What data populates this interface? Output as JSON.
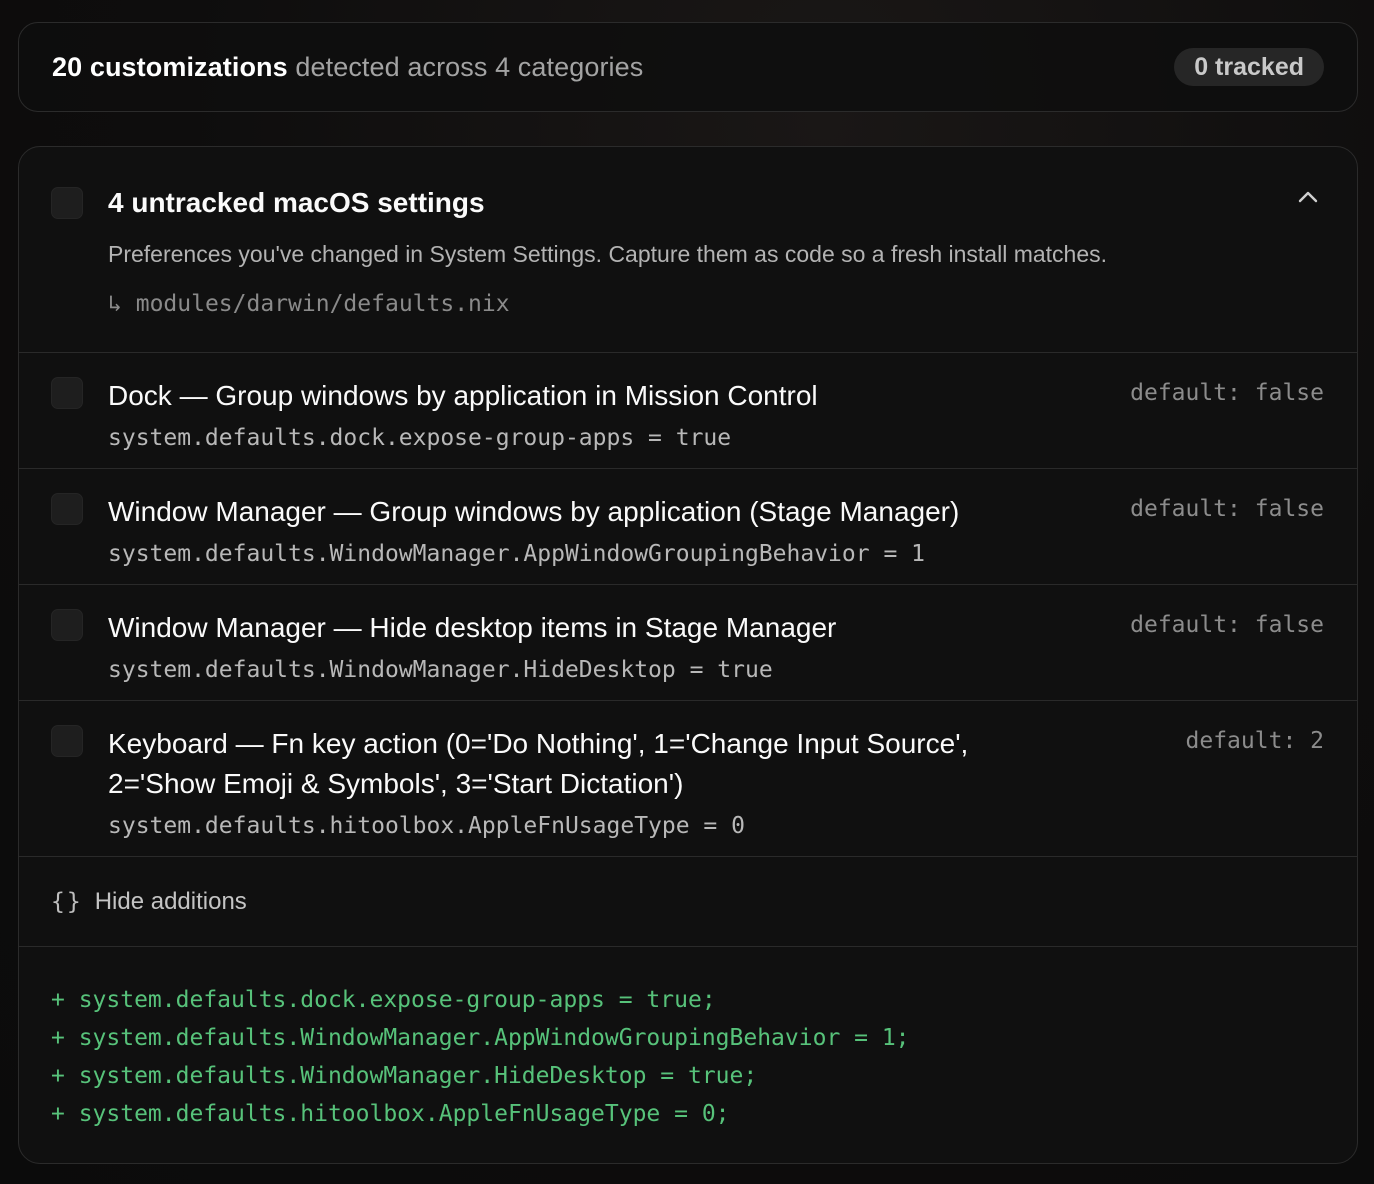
{
  "summary": {
    "count_text": "20 customizations",
    "rest_text": " detected across 4 categories",
    "tracked_badge": "0 tracked"
  },
  "group": {
    "title": "4 untracked macOS settings",
    "description": "Preferences you've changed in System Settings. Capture them as code so a fresh install matches.",
    "path_arrow": "↳",
    "path": "modules/darwin/defaults.nix"
  },
  "settings": [
    {
      "title": "Dock — Group windows by application in Mission Control",
      "key": "system.defaults.dock.expose-group-apps = true",
      "default": "default: false"
    },
    {
      "title": "Window Manager — Group windows by application (Stage Manager)",
      "key": "system.defaults.WindowManager.AppWindowGroupingBehavior = 1",
      "default": "default: false"
    },
    {
      "title": "Window Manager — Hide desktop items in Stage Manager",
      "key": "system.defaults.WindowManager.HideDesktop = true",
      "default": "default: false"
    },
    {
      "title_line1": "Keyboard — Fn key action (0='Do Nothing', 1='Change Input Source',",
      "title_line2": "2='Show Emoji & Symbols', 3='Start Dictation')",
      "key": "system.defaults.hitoolbox.AppleFnUsageType = 0",
      "default": "default: 2"
    }
  ],
  "additions": {
    "icon": "{}",
    "toggle_label": "Hide additions",
    "lines": [
      "+ system.defaults.dock.expose-group-apps = true;",
      "+ system.defaults.WindowManager.AppWindowGroupingBehavior = 1;",
      "+ system.defaults.WindowManager.HideDesktop = true;",
      "+ system.defaults.hitoolbox.AppleFnUsageType = 0;"
    ]
  },
  "colors": {
    "background": "#0e0d0d",
    "card": "#101010",
    "border": "#2b2b2b",
    "diff_green": "#57c27a",
    "badge_bg": "#262626"
  }
}
